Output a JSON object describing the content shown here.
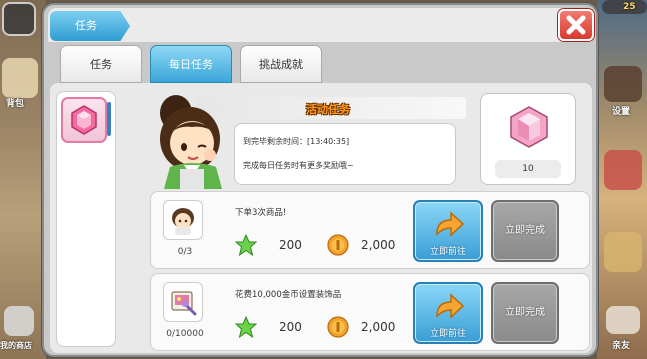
{
  "hud": {
    "right_top_number": "25",
    "left_labels": [
      "背包",
      "我的商店"
    ],
    "right_labels": [
      "设置",
      "亲友"
    ]
  },
  "dialog": {
    "title": "任务",
    "tabs": [
      {
        "label": "任务",
        "active": false
      },
      {
        "label": "每日任务",
        "active": true
      },
      {
        "label": "挑战成就",
        "active": false
      }
    ]
  },
  "event": {
    "title": "活动任务",
    "time_label": "到完毕剩余时间：[13:40:35]",
    "hint": "完成每日任务时有更多奖励哦~"
  },
  "reward": {
    "icon": "pink-gem-icon",
    "count": "10"
  },
  "tasks": [
    {
      "icon": "character-avatar-icon",
      "progress": "0/3",
      "description": "下单3次商品!",
      "exp": "200",
      "coins": "2,000",
      "go_label": "立即前往",
      "complete_label": "立即完成"
    },
    {
      "icon": "decoration-item-icon",
      "progress": "0/10000",
      "description": "花费10,000金币设置装饰品",
      "exp": "200",
      "coins": "2,000",
      "go_label": "立即前往",
      "complete_label": "立即完成"
    }
  ],
  "colors": {
    "accent": "#3aa6d8",
    "close": "#d63a2f",
    "event_title": "#ff9a1a"
  }
}
